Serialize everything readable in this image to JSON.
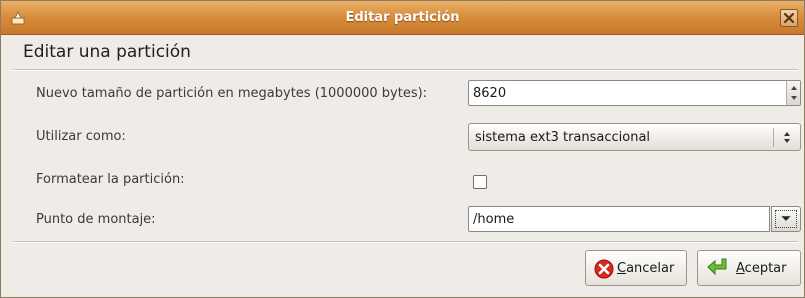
{
  "window": {
    "title": "Editar partición",
    "heading": "Editar una partición"
  },
  "form": {
    "size_label": "Nuevo tamaño de partición en megabytes (1000000 bytes):",
    "size_value": "8620",
    "use_as_label": "Utilizar como:",
    "use_as_value": "sistema ext3 transaccional",
    "format_label": "Formatear la partición:",
    "format_checked": false,
    "mount_label": "Punto de montaje:",
    "mount_value": "/home"
  },
  "buttons": {
    "cancel_label": "Cancelar",
    "ok_label": "Aceptar"
  },
  "icons": {
    "app": "app-icon",
    "close": "close-icon",
    "cancel": "cancel-icon",
    "ok": "ok-arrow-icon"
  },
  "colors": {
    "titlebar": "#d88f3d",
    "window_bg": "#efebe7",
    "cancel_icon": "#d9291f",
    "ok_icon": "#5fae2e"
  }
}
